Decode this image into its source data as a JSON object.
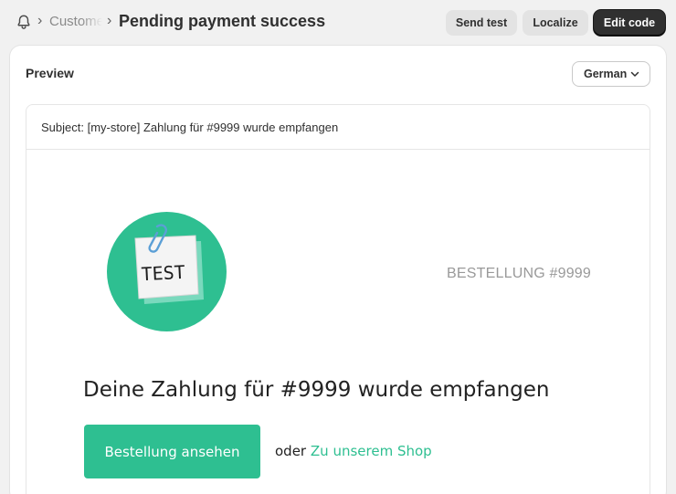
{
  "breadcrumb": {
    "parent_label": "Customers",
    "title": "Pending payment success"
  },
  "actions": {
    "send_test_label": "Send test",
    "localize_label": "Localize",
    "edit_code_label": "Edit code"
  },
  "preview": {
    "label": "Preview",
    "language_selected": "German"
  },
  "email": {
    "subject": "Subject: [my-store] Zahlung für #9999 wurde empfangen",
    "logo_text": "TEST",
    "order_label": "BESTELLUNG #9999",
    "headline": "Deine Zahlung für #9999 wurde empfangen",
    "view_order_button": "Bestellung ansehen",
    "or_text": "oder",
    "shop_link": "Zu unserem Shop"
  },
  "colors": {
    "accent": "#2ebf91",
    "primary_button": "#303030",
    "background": "#f1f1f1"
  }
}
